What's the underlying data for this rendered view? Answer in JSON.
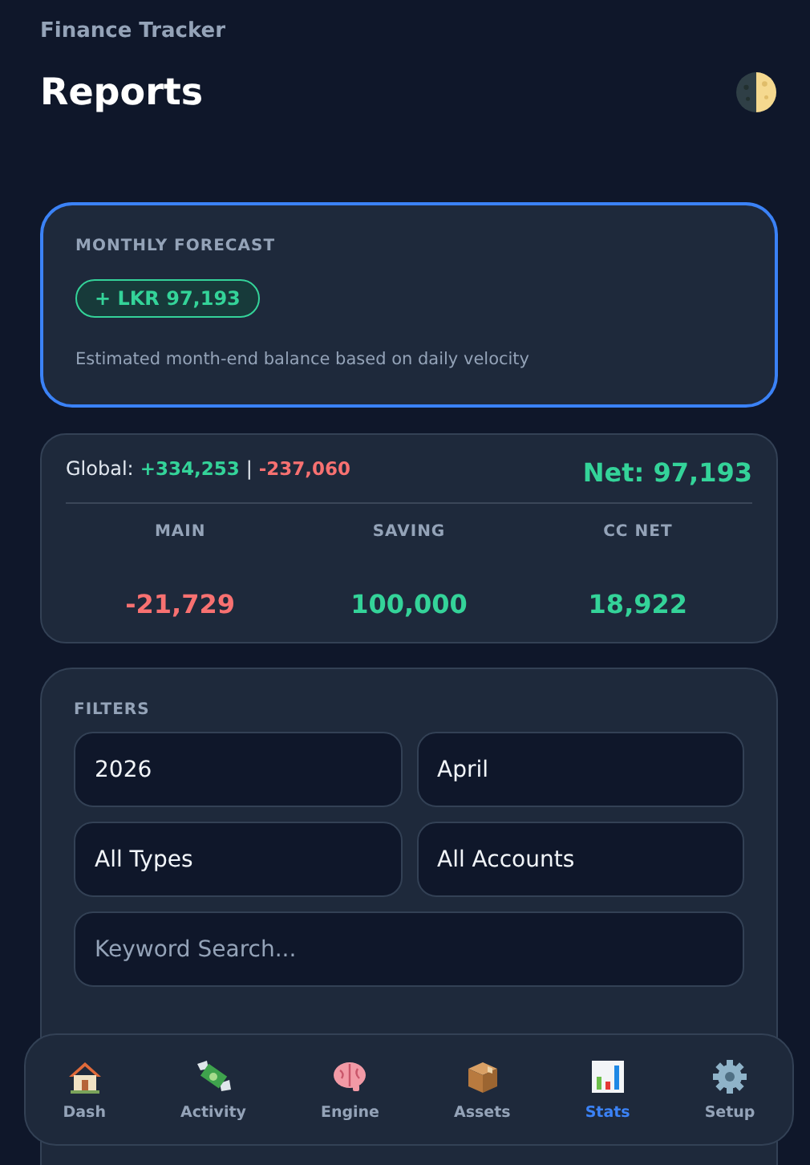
{
  "app_name": "Finance Tracker",
  "page_title": "Reports",
  "forecast": {
    "label": "MONTHLY FORECAST",
    "amount": "+ LKR 97,193",
    "note": "Estimated month-end balance based on daily velocity"
  },
  "summary": {
    "global_label": "Global:",
    "income": "+334,253",
    "separator": "|",
    "expense": "-237,060",
    "net": "Net: 97,193",
    "accounts": [
      {
        "name": "MAIN",
        "value": "-21,729",
        "negative": true
      },
      {
        "name": "SAVING",
        "value": "100,000",
        "negative": false
      },
      {
        "name": "CC NET",
        "value": "18,922",
        "negative": false
      }
    ]
  },
  "filters": {
    "label": "FILTERS",
    "year": "2026",
    "month": "April",
    "type": "All Types",
    "account": "All Accounts",
    "search": {
      "placeholder": "Keyword Search..."
    }
  },
  "nav": [
    {
      "label": "Dash",
      "kind": "house",
      "selected": false
    },
    {
      "label": "Activity",
      "kind": "money",
      "selected": false
    },
    {
      "label": "Engine",
      "kind": "brain",
      "selected": false
    },
    {
      "label": "Assets",
      "kind": "box",
      "selected": false
    },
    {
      "label": "Stats",
      "kind": "chart",
      "selected": true
    },
    {
      "label": "Setup",
      "kind": "gear",
      "selected": false
    }
  ]
}
